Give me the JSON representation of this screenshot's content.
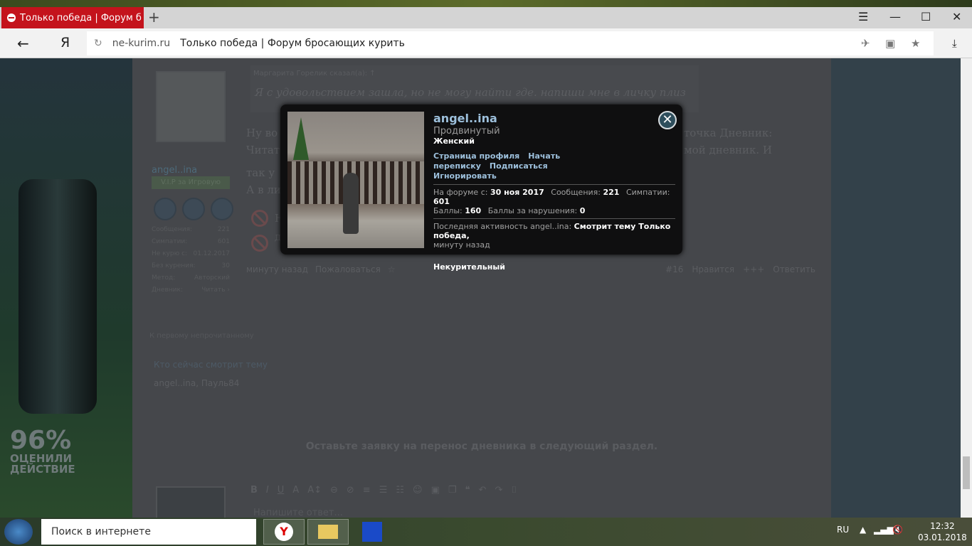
{
  "browser": {
    "tab_title": "Только победа | Форум б",
    "new_tab": "+",
    "domain": "ne-kurim.ru",
    "page_title": "Только победа | Форум бросающих курить"
  },
  "sidebar_ad": {
    "percent": "96%",
    "line1": "ОЦЕНИЛИ",
    "line2": "ДЕЙСТВИЕ"
  },
  "post": {
    "author": "angel..ina",
    "badge": "V.I.P за Игровую",
    "stats": [
      {
        "label": "Сообщения:",
        "value": "221"
      },
      {
        "label": "Симпатии:",
        "value": "601"
      },
      {
        "label": "Не курю с:",
        "value": "01.12.2017"
      },
      {
        "label": "Без курения:",
        "value": "30"
      },
      {
        "label": "Метод:",
        "value": "Авторский"
      },
      {
        "label": "Дневник:",
        "value": "Читать ›"
      }
    ],
    "quote_author": "Маргарита Горелик сказал(а): ↑",
    "quote_text": "Я с удовольствием зашла, но не могу найти где. напиши мне в личку плиз",
    "text_line1_start": "Ну во",
    "text_line1_end": "точка Дневник:",
    "text_line2_start": "Читат",
    "text_line2_end": "мой дневник. И",
    "text_line3_start": "так у",
    "text_line4_start": "А в ли",
    "sig1": "Н",
    "sig2": "Д",
    "time": "минуту назад",
    "report": "Пожаловаться",
    "number": "#16",
    "like": "Нравится",
    "plus": "+++",
    "reply": "Ответить"
  },
  "unread_link": "К первому непрочитанному",
  "who_viewing_title": "Кто сейчас смотрит тему",
  "who_viewing": "angel..ina, Пауль84",
  "notice": "Оставьте заявку на перенос дневника в следующий раздел.",
  "reply_placeholder": "Напишите ответ...",
  "popup": {
    "name": "angel..ina",
    "title": "Продвинутый",
    "gender": "Женский",
    "links": [
      "Страница профиля",
      "Начать переписку",
      "Подписаться",
      "Игнорировать"
    ],
    "joined_label": "На форуме с:",
    "joined": "30 ноя 2017",
    "messages_label": "Сообщения:",
    "messages": "221",
    "likes_label": "Симпатии:",
    "likes": "601",
    "points_label": "Баллы:",
    "points": "160",
    "warn_label": "Баллы за нарушения:",
    "warn": "0",
    "activity_label": "Последняя активность angel..ina:",
    "activity": "Смотрит тему Только победа,",
    "activity_time": "минуту назад",
    "status": "Некурительный"
  },
  "taskbar": {
    "search_placeholder": "Поиск в интернете",
    "lang": "RU",
    "time": "12:32",
    "date": "03.01.2018"
  }
}
